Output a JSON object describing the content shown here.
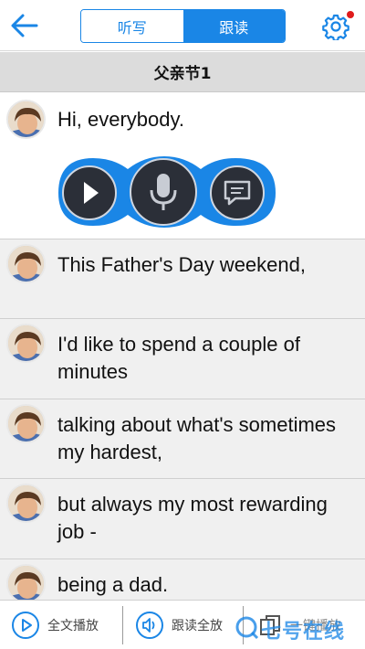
{
  "header": {
    "tabs": [
      {
        "label": "听写",
        "selected": false
      },
      {
        "label": "跟读",
        "selected": true
      }
    ],
    "accent_color": "#1a86e6",
    "notification_color": "#e01b1b"
  },
  "lesson": {
    "title": "父亲节1"
  },
  "sentences": [
    {
      "text": "Hi, everybody."
    },
    {
      "text": "This Father's Day weekend,"
    },
    {
      "text": "I'd like to spend a couple of minutes"
    },
    {
      "text": "talking about what's sometimes my hardest,"
    },
    {
      "text": "but always my most rewarding job -"
    },
    {
      "text": "being a dad."
    }
  ],
  "controls": {
    "play_icon": "play-icon",
    "record_icon": "microphone-icon",
    "compare_icon": "chat-bubble-icon"
  },
  "bottom_bar": {
    "play_all_label": "全文播放",
    "repeat_all_label": "跟读全放",
    "third_label": "一键播放"
  },
  "watermark": {
    "text": "七号在线"
  }
}
